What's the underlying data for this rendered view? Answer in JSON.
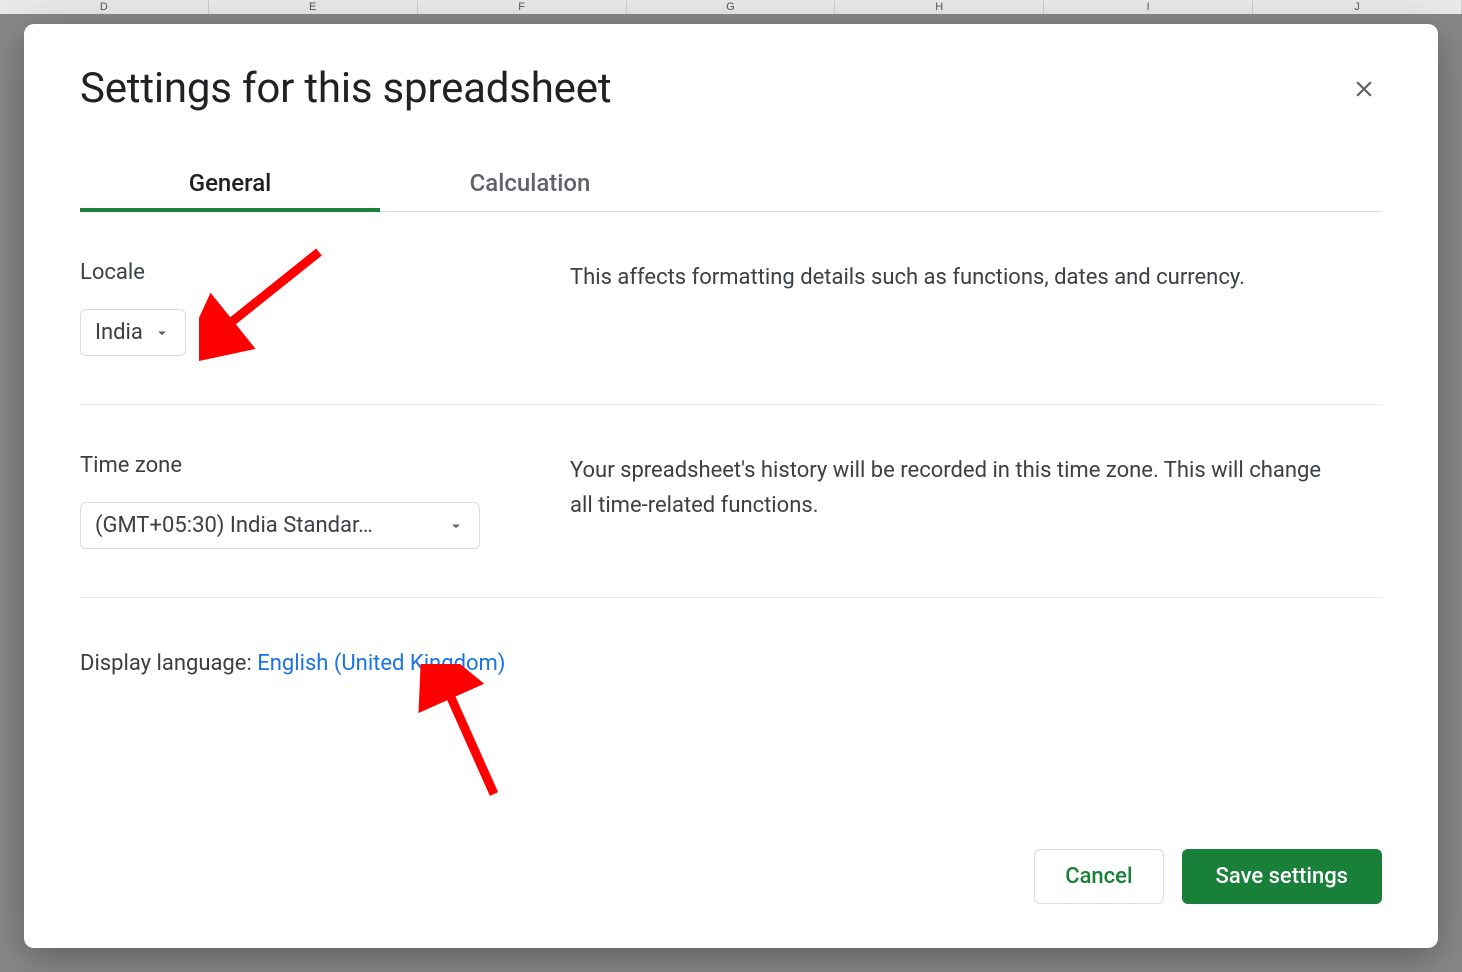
{
  "bg_columns": [
    "D",
    "E",
    "F",
    "G",
    "H",
    "I",
    "J"
  ],
  "dialog": {
    "title": "Settings for this spreadsheet"
  },
  "tabs": {
    "general": "General",
    "calculation": "Calculation"
  },
  "locale": {
    "label": "Locale",
    "value": "India",
    "description": "This affects formatting details such as functions, dates and currency."
  },
  "timezone": {
    "label": "Time zone",
    "value": "(GMT+05:30) India Standar…",
    "description": "Your spreadsheet's history will be recorded in this time zone. This will change all time-related functions."
  },
  "language": {
    "label": "Display language: ",
    "value": "English (United Kingdom)"
  },
  "buttons": {
    "cancel": "Cancel",
    "save": "Save settings"
  }
}
